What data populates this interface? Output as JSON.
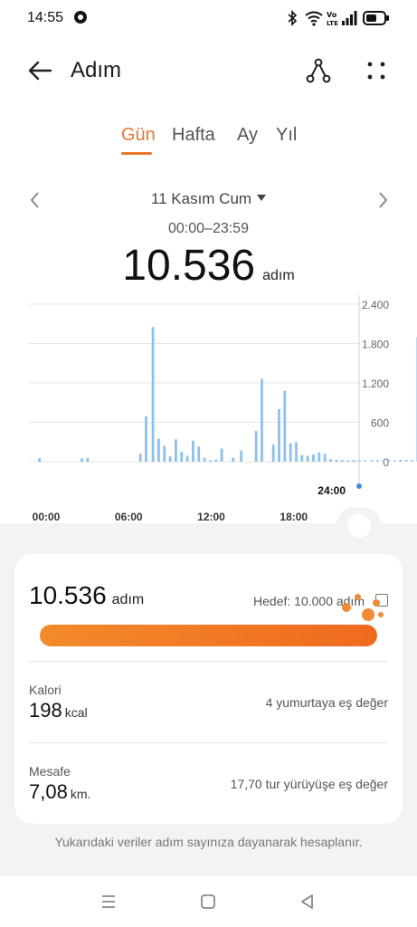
{
  "status_bar": {
    "time": "14:55",
    "signal_text": "Vo LTE"
  },
  "header": {
    "title": "Adım",
    "back_icon": "arrow-left-icon",
    "share_icon": "share-icon",
    "more_icon": "more-dots-icon"
  },
  "tabs": [
    {
      "label": "Gün",
      "active": true
    },
    {
      "label": "Hafta",
      "active": false
    },
    {
      "label": "Ay",
      "active": false
    },
    {
      "label": "Yıl",
      "active": false
    }
  ],
  "date": {
    "label": "11 Kasım Cum",
    "range": "00:00–23:59"
  },
  "summary": {
    "steps": "10.536",
    "unit": "adım"
  },
  "chart_data": {
    "type": "bar",
    "x_tick_labels": [
      "00:00",
      "06:00",
      "12:00",
      "18:00"
    ],
    "end_label": "24:00",
    "y_tick_labels": [
      "2.400",
      "1.800",
      "1.200",
      "600",
      "0"
    ],
    "ylim": [
      0,
      2400
    ],
    "grid": true,
    "bar_color": "#8cc0ee",
    "marker_color": "#3e8be2",
    "minutes": [
      9,
      46,
      51,
      97,
      102,
      108,
      113,
      118,
      123,
      128,
      133,
      138,
      143,
      148,
      153,
      158,
      163,
      168,
      178,
      185,
      198,
      203,
      213,
      218,
      223,
      228,
      233,
      238,
      243,
      248,
      253,
      258,
      263,
      268,
      273,
      278,
      283,
      288,
      293,
      299,
      304,
      309,
      314,
      319,
      324,
      329,
      334,
      339
    ],
    "values": [
      55,
      50,
      60,
      120,
      690,
      2050,
      350,
      240,
      80,
      340,
      150,
      90,
      320,
      230,
      60,
      20,
      30,
      200,
      60,
      170,
      470,
      1260,
      260,
      800,
      1080,
      280,
      300,
      100,
      90,
      110,
      140,
      120,
      40,
      30,
      25,
      20,
      25,
      30,
      20,
      20,
      25,
      30,
      25,
      20,
      30,
      25,
      20,
      1900
    ]
  },
  "card": {
    "steps": "10.536",
    "steps_unit": "adım",
    "goal": "Hedef: 10.000 adım",
    "progress_percent": 100,
    "accent": "#f07a26"
  },
  "metrics": [
    {
      "label": "Kalori",
      "value": "198",
      "unit": "kcal",
      "equivalent": "4 yumurtaya eş değer"
    },
    {
      "label": "Mesafe",
      "value": "7,08",
      "unit": "km.",
      "equivalent": "17,70 tur yürüyüşe eş değer"
    }
  ],
  "footnote": "Yukarıdaki veriler adım sayınıza dayanarak hesaplanır.",
  "nav": {
    "menu_icon": "menu-icon",
    "home_icon": "home-square-icon",
    "back_icon": "back-triangle-icon"
  }
}
